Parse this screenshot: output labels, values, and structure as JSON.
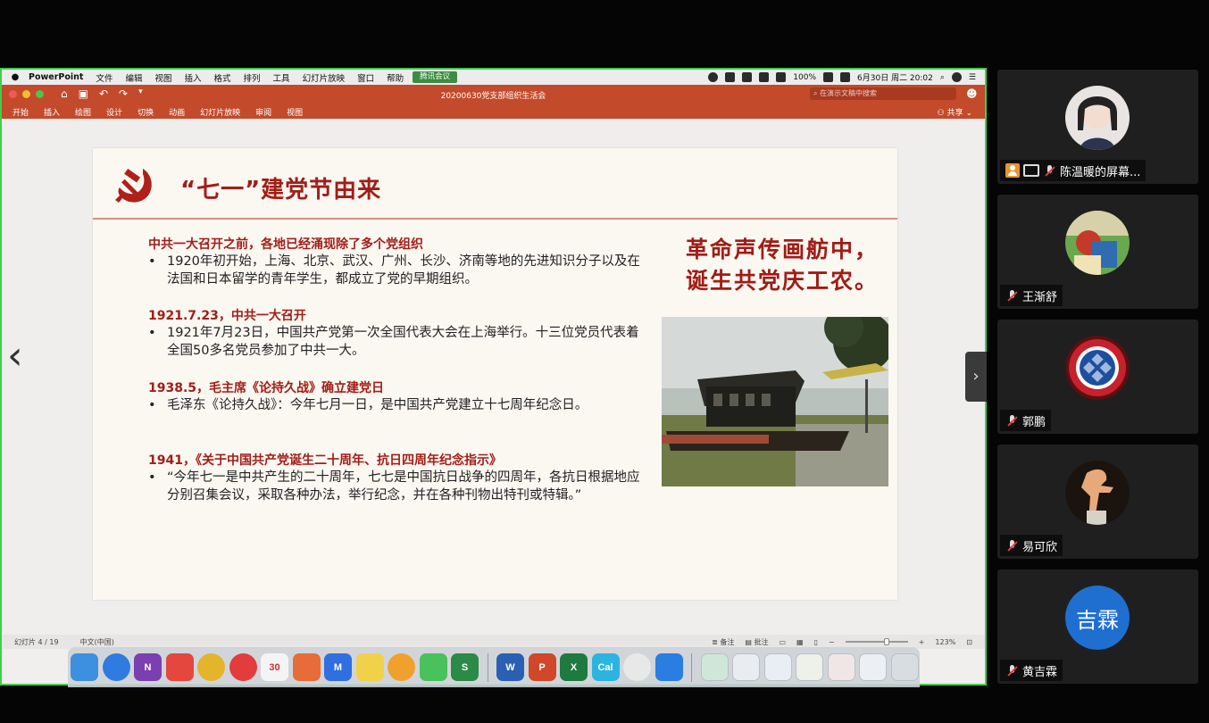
{
  "menubar": {
    "app_name": "PowerPoint",
    "menus": [
      "文件",
      "编辑",
      "视图",
      "插入",
      "格式",
      "排列",
      "工具",
      "幻灯片放映",
      "窗口",
      "帮助"
    ],
    "meeting_badge": "腾讯会议",
    "battery": "100%",
    "datetime": "6月30日 周二 20:02"
  },
  "titlebar": {
    "document_title": "20200630党支部组织生活会",
    "search_placeholder": "在演示文稿中搜索"
  },
  "ribbon": {
    "tabs": [
      "开始",
      "插入",
      "绘图",
      "设计",
      "切换",
      "动画",
      "幻灯片放映",
      "审阅",
      "视图"
    ],
    "share_label": "共享"
  },
  "slide": {
    "title": "“七一”建党节由来",
    "sections": [
      {
        "heading": "中共一大召开之前，各地已经涌现除了多个党组织",
        "body": "1920年初开始，上海、北京、武汉、广州、长沙、济南等地的先进知识分子以及在法国和日本留学的青年学生，都成立了党的早期组织。"
      },
      {
        "heading": "1921.7.23，中共一大召开",
        "body": "1921年7月23日，中国共产党第一次全国代表大会在上海举行。十三位党员代表着全国50多名党员参加了中共一大。"
      },
      {
        "heading": "1938.5，毛主席《论持久战》确立建党日",
        "body": "毛泽东《论持久战》：今年七月一日，是中国共产党建立十七周年纪念日。"
      },
      {
        "heading": "1941，《关于中国共产党诞生二十周年、抗日四周年纪念指示》",
        "body": "“今年七一是中共产生的二十周年，七七是中国抗日战争的四周年，各抗日根据地应分别召集会议，采取各种办法，举行纪念，并在各种刊物出特刊或特辑。”"
      }
    ],
    "bullet": "•",
    "calligraphy_line1": "革命声传画舫中，",
    "calligraphy_line2": "诞生共党庆工农。"
  },
  "statusbar": {
    "slide_counter": "幻灯片 4 / 19",
    "language": "中文(中国)",
    "notes_label": "备注",
    "comments_label": "批注",
    "zoom_level": "123%",
    "zoom_fraction": 0.66
  },
  "dock": {
    "apps": [
      {
        "name": "finder-icon",
        "label": "",
        "color": "#3d8fe0"
      },
      {
        "name": "safari-icon",
        "label": "",
        "color": "#2f7be0"
      },
      {
        "name": "onenote-icon",
        "label": "N",
        "color": "#7b3fb0"
      },
      {
        "name": "pdf-expert-icon",
        "label": "",
        "color": "#e3473d"
      },
      {
        "name": "chrome-icon",
        "label": "",
        "color": "#e4b42b"
      },
      {
        "name": "netease-music-icon",
        "label": "",
        "color": "#e23c3c"
      },
      {
        "name": "calendar-icon",
        "label": "30",
        "color": "#f4f4f4"
      },
      {
        "name": "keynote-remote-icon",
        "label": "",
        "color": "#e86b3a"
      },
      {
        "name": "mweb-icon",
        "label": "M",
        "color": "#2f6fe0"
      },
      {
        "name": "notes-icon",
        "label": "",
        "color": "#f2d14a"
      },
      {
        "name": "photos-icon",
        "label": "",
        "color": "#f0a12d"
      },
      {
        "name": "wechat-icon",
        "label": "",
        "color": "#49c15c"
      },
      {
        "name": "scrivener-icon",
        "label": "S",
        "color": "#2b8a45"
      },
      {
        "name": "word-icon",
        "label": "W",
        "color": "#2b5fb3"
      },
      {
        "name": "powerpoint-icon",
        "label": "P",
        "color": "#d0472a"
      },
      {
        "name": "excel-icon",
        "label": "X",
        "color": "#1f7a3f"
      },
      {
        "name": "cal-app-icon",
        "label": "Cal",
        "color": "#2bb4e0"
      },
      {
        "name": "clock-icon",
        "label": "",
        "color": "#e8e8e8"
      },
      {
        "name": "tencent-meeting-icon",
        "label": "",
        "color": "#2a7de1"
      }
    ],
    "docs": [
      {
        "name": "dock-doc-1-icon",
        "color": "#cfe7d8"
      },
      {
        "name": "dock-doc-2-icon",
        "color": "#e9ecf0"
      },
      {
        "name": "dock-doc-3-icon",
        "color": "#e8eef4"
      },
      {
        "name": "dock-doc-4-icon",
        "color": "#eef0ea"
      },
      {
        "name": "dock-doc-5-icon",
        "color": "#f1e6e6"
      },
      {
        "name": "dock-doc-6-icon",
        "color": "#eceff3"
      },
      {
        "name": "trash-icon",
        "color": "#d8dde2"
      }
    ]
  },
  "participants": [
    {
      "name": "陈温暖的屏幕...",
      "presenter": true,
      "avatar_type": "photo-girl"
    },
    {
      "name": "王渐舒",
      "presenter": false,
      "avatar_type": "photo-cartoon"
    },
    {
      "name": "郭鹏",
      "presenter": false,
      "avatar_type": "photo-bayern"
    },
    {
      "name": "易可欣",
      "presenter": false,
      "avatar_type": "photo-figure"
    },
    {
      "name": "黄吉霖",
      "presenter": false,
      "avatar_type": "initials",
      "initials": "吉霖",
      "color": "#1f6fd1"
    }
  ],
  "colors": {
    "accent_red": "#a11e18",
    "ribbon": "#c34a2a",
    "active_border": "#3fcf4a"
  }
}
